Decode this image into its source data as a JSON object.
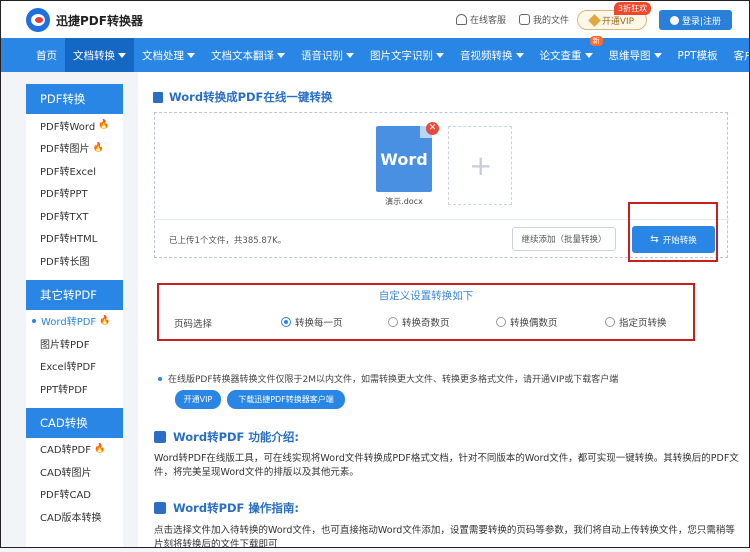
{
  "header": {
    "brand": "迅捷PDF转换器",
    "links": [
      {
        "label": "在线客服",
        "icon": "headset-icon"
      },
      {
        "label": "我的文件",
        "icon": "file-icon"
      }
    ],
    "vip_label": "开通VIP",
    "vip_badge": "3折狂欢",
    "login_label": "登录|注册"
  },
  "nav": {
    "items": [
      {
        "label": "首页",
        "caret": false,
        "active": false
      },
      {
        "label": "文档转换",
        "caret": true,
        "active": true
      },
      {
        "label": "文档处理",
        "caret": true,
        "active": false
      },
      {
        "label": "文档文本翻译",
        "caret": true,
        "active": false
      },
      {
        "label": "语音识别",
        "caret": true,
        "active": false
      },
      {
        "label": "图片文字识别",
        "caret": true,
        "active": false
      },
      {
        "label": "音视频转换",
        "caret": true,
        "active": false
      },
      {
        "label": "论文查重",
        "caret": true,
        "active": false,
        "badge": "新"
      },
      {
        "label": "思维导图",
        "caret": true,
        "active": false
      },
      {
        "label": "PPT模板",
        "caret": false,
        "active": false
      },
      {
        "label": "客户端",
        "caret": true,
        "active": false
      }
    ]
  },
  "sidebar": {
    "groups": [
      {
        "title": "PDF转换",
        "items": [
          {
            "label": "PDF转Word",
            "hot": true
          },
          {
            "label": "PDF转图片",
            "hot": true
          },
          {
            "label": "PDF转Excel",
            "hot": false
          },
          {
            "label": "PDF转PPT",
            "hot": false
          },
          {
            "label": "PDF转TXT",
            "hot": false
          },
          {
            "label": "PDF转HTML",
            "hot": false
          },
          {
            "label": "PDF转长图",
            "hot": false
          }
        ]
      },
      {
        "title": "其它转PDF",
        "items": [
          {
            "label": "Word转PDF",
            "hot": true,
            "active": true
          },
          {
            "label": "图片转PDF",
            "hot": false
          },
          {
            "label": "Excel转PDF",
            "hot": false
          },
          {
            "label": "PPT转PDF",
            "hot": false
          }
        ]
      },
      {
        "title": "CAD转换",
        "items": [
          {
            "label": "CAD转PDF",
            "hot": true
          },
          {
            "label": "CAD转图片",
            "hot": false
          },
          {
            "label": "PDF转CAD",
            "hot": false
          },
          {
            "label": "CAD版本转换",
            "hot": false
          }
        ]
      }
    ]
  },
  "main": {
    "title": "Word转换成PDF在线一键转换",
    "file": {
      "icon_text": "Word",
      "name": "演示.docx"
    },
    "upload_info": "已上传1个文件，共385.87K。",
    "continue_label": "继续添加（批量转换）",
    "start_label": "开始转换",
    "settings": {
      "title": "自定义设置转换如下",
      "option_label": "页码选择",
      "options": [
        {
          "label": "转换每一页",
          "selected": true
        },
        {
          "label": "转换奇数页",
          "selected": false
        },
        {
          "label": "转换偶数页",
          "selected": false
        },
        {
          "label": "指定页转换",
          "selected": false
        }
      ]
    },
    "notice": "在线版PDF转换器转换文件仅限于2M以内文件，如需转换更大文件、转换更多格式文件，请开通VIP或下载客户端",
    "notice_buttons": [
      "开通VIP",
      "下载迅捷PDF转换器客户端"
    ],
    "intro_title": "Word转PDF 功能介绍:",
    "intro_text": "Word转PDF在线版工具，可在线实现将Word文件转换成PDF格式文档，针对不同版本的Word文件，都可实现一键转换。其转换后的PDF文件，将完美呈现Word文件的排版以及其他元素。",
    "guide_title": "Word转PDF 操作指南:",
    "guide_text": "点击选择文件加入待转换的Word文件，也可直接拖动Word文件添加，设置需要转换的页码等参数，我们将自动上传转换文件，您只需稍等片刻将转换后的文件下载即可"
  }
}
